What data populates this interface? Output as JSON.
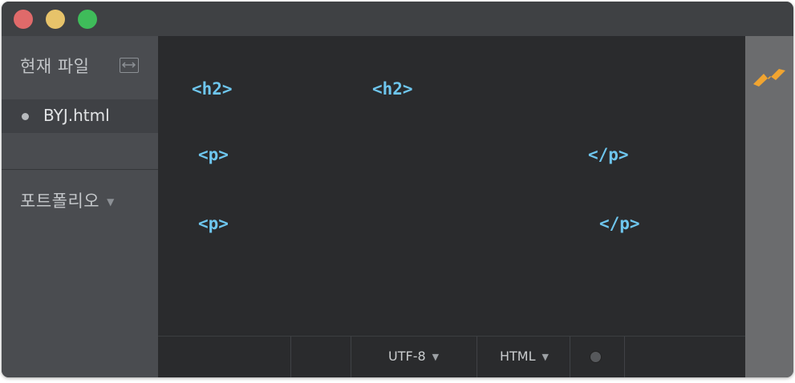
{
  "sidebar": {
    "title": "현재 파일",
    "file_name": "BYJ.html",
    "folder": "포트폴리오"
  },
  "editor": {
    "lines": [
      {
        "open": "<h2>",
        "close": "<h2>"
      },
      {
        "open": "<p>",
        "close": "</p>"
      },
      {
        "open": "<p>",
        "close": "</p>"
      }
    ]
  },
  "status": {
    "encoding": "UTF-8",
    "language": "HTML"
  },
  "colors": {
    "tag": "#6ec6ee",
    "editor_bg": "#2a2b2d",
    "sidebar_bg": "#4a4c50",
    "accent_bolt": "#f0a430"
  },
  "icons": [
    "split-view-icon",
    "file-dot-icon",
    "folder-caret-icon",
    "dropdown-caret-icon",
    "status-dot-icon",
    "live-preview-bolt-icon"
  ]
}
